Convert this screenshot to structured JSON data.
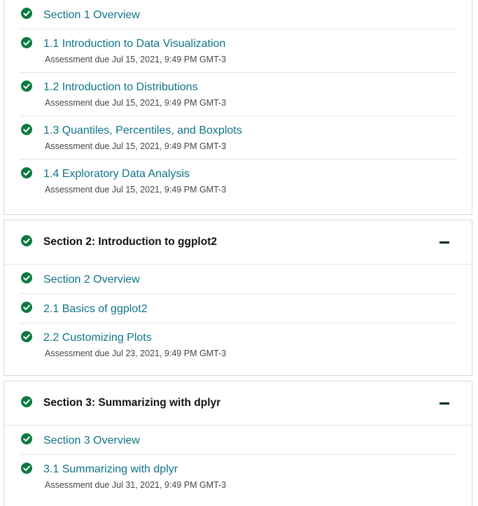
{
  "colors": {
    "link": "#0e7488",
    "check": "#0b7a40",
    "heading": "#111111",
    "muted": "#454545",
    "border": "#d8d8d8"
  },
  "section1": {
    "items": [
      {
        "label": "Section 1 Overview",
        "due": ""
      },
      {
        "label": "1.1 Introduction to Data Visualization",
        "due": "Assessment due Jul 15, 2021, 9:49 PM GMT-3"
      },
      {
        "label": "1.2 Introduction to Distributions",
        "due": "Assessment due Jul 15, 2021, 9:49 PM GMT-3"
      },
      {
        "label": "1.3 Quantiles, Percentiles, and Boxplots",
        "due": "Assessment due Jul 15, 2021, 9:49 PM GMT-3"
      },
      {
        "label": "1.4 Exploratory Data Analysis",
        "due": "Assessment due Jul 15, 2021, 9:49 PM GMT-3"
      }
    ]
  },
  "section2": {
    "title": "Section 2: Introduction to ggplot2",
    "items": [
      {
        "label": "Section 2 Overview",
        "due": ""
      },
      {
        "label": "2.1 Basics of ggplot2",
        "due": ""
      },
      {
        "label": "2.2 Customizing Plots",
        "due": "Assessment due Jul 23, 2021, 9:49 PM GMT-3"
      }
    ]
  },
  "section3": {
    "title": "Section 3: Summarizing with dplyr",
    "items": [
      {
        "label": "Section 3 Overview",
        "due": ""
      },
      {
        "label": "3.1 Summarizing with dplyr",
        "due": "Assessment due Jul 31, 2021, 9:49 PM GMT-3"
      }
    ]
  },
  "icons": {
    "check": "check-circle-icon",
    "collapse": "minus-icon"
  }
}
